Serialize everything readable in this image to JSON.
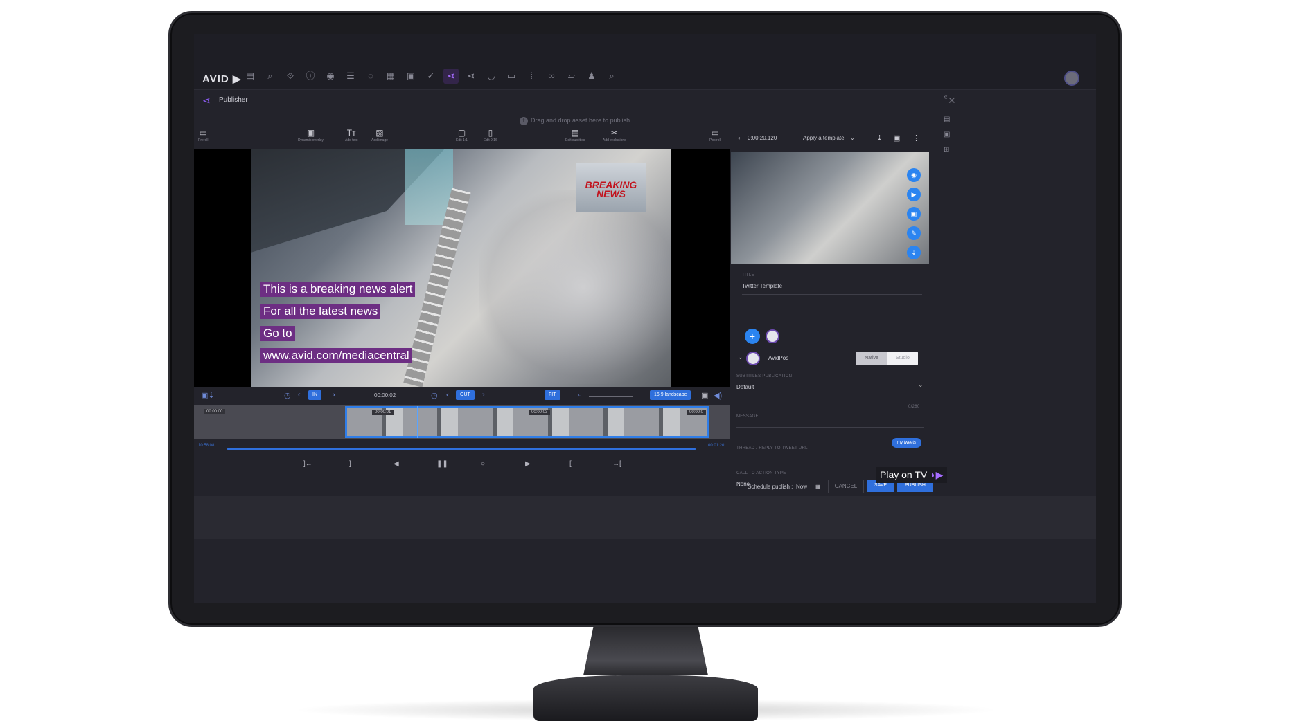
{
  "app": {
    "logo": "AVID ▶",
    "panel_title": "Publisher"
  },
  "toolbar": {
    "icons": [
      "folder-icon",
      "search-icon",
      "browse-icon",
      "info-icon",
      "mark-icon",
      "rundown-icon",
      "chat-icon",
      "story-icon",
      "media-icon",
      "check-icon",
      "publisher-icon",
      "share-icon",
      "cloud-icon",
      "capture-icon",
      "counter-icon",
      "link-icon",
      "log-icon",
      "trophy-icon",
      "zoom-icon"
    ],
    "glyphs": [
      "▤",
      "⌕",
      "⟐",
      "ⓘ",
      "◉",
      "☰",
      "◌",
      "▦",
      "▣",
      "✓",
      "⋖",
      "⋖",
      "◡",
      "▭",
      "⁞",
      "∞",
      "▱",
      "♟",
      "⌕"
    ]
  },
  "dropzone": {
    "icon": "+",
    "text": "Drag and drop asset here to publish"
  },
  "editbar": {
    "preroll_label": "Preroll",
    "dynamic_overlay": "Dynamic overlay",
    "add_text": "Add text",
    "add_image": "Add image",
    "edit_11": "Edit 1:1",
    "edit_916": "Edit 9:16",
    "edit_subtitles": "Edit subtitles",
    "add_exclusions": "Add exclusions",
    "postroll_label": "Postroll",
    "text_glyph": "Tт"
  },
  "video": {
    "breaking": "BREAKING NEWS",
    "captions": [
      "This is a breaking news alert",
      "For all the latest news",
      "Go to",
      "www.avid.com/mediacentral"
    ]
  },
  "controls": {
    "in_label": "IN",
    "out_label": "OUT",
    "timecode": "00:00:02",
    "fit_label": "FIT",
    "aspect_label": "16:9 landscape"
  },
  "timeline": {
    "tc_start": "00:00:00",
    "tc_1": "00:00:01",
    "tc_2": "00:00:03",
    "tc_3": "00:00:0",
    "left_time": "10:58:08",
    "right_time": "00:01:20"
  },
  "transport": {
    "glyphs": [
      "]←",
      "]",
      "◀",
      "❚❚",
      "○",
      "▶",
      "[",
      "→["
    ]
  },
  "right_panel": {
    "duration": "0:00:20.120",
    "apply_template": "Apply a template",
    "title_label": "TITLE",
    "title_value": "Twitter Template",
    "account_name": "AvidPos",
    "mode_native": "Native",
    "mode_studio": "Studio",
    "subtitles_label": "SUBTITLES PUBLICATION",
    "subtitles_value": "Default",
    "message_label": "MESSAGE",
    "char_count": "0/280",
    "thread_label": "THREAD / REPLY TO TWEET URL",
    "my_tweets": "my tweets",
    "cta_label": "CALL TO ACTION TYPE",
    "cta_value": "None"
  },
  "footer": {
    "schedule": "Schedule publish :",
    "schedule_value": "Now",
    "cancel": "CANCEL",
    "save": "SAVE",
    "publish": "PUBLISH"
  },
  "overlay": {
    "play_on_tv": "Play on TV",
    "tv_mark": "◗▶"
  }
}
